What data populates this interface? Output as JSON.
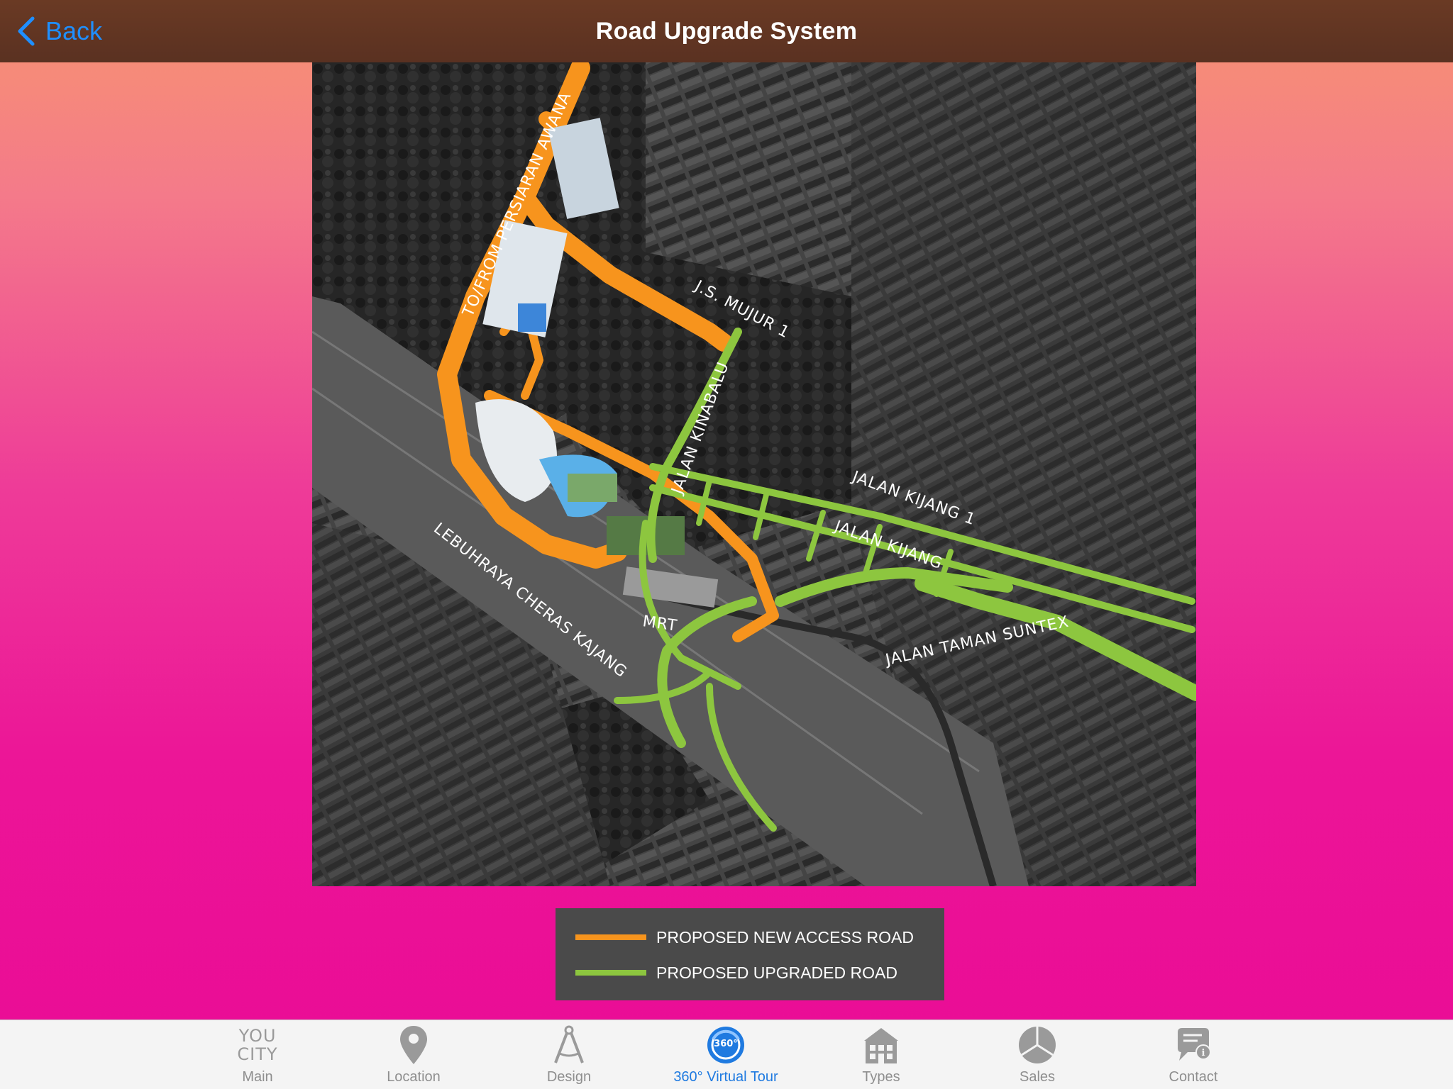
{
  "nav": {
    "back_label": "Back",
    "title": "Road Upgrade System"
  },
  "map": {
    "labels": {
      "persiaran": "TO/FROM PERSIARAN AWANA",
      "mujur": "J.S. MUJUR 1",
      "kinabalu": "JALAN KINABALU",
      "kijang1": "JALAN KIJANG 1",
      "kijang": "JALAN KIJANG",
      "lebuhraya": "LEBUHRAYA CHERAS KAJANG",
      "mrt": "MRT",
      "suntex": "JALAN TAMAN SUNTEX"
    },
    "colors": {
      "new_access_road": "#f7941d",
      "upgraded_road": "#8dc63f"
    }
  },
  "legend": {
    "items": [
      {
        "label": "PROPOSED NEW ACCESS ROAD",
        "color": "#f7941d"
      },
      {
        "label": "PROPOSED UPGRADED ROAD",
        "color": "#8dc63f"
      }
    ]
  },
  "tabbar": {
    "items": [
      {
        "label": "Main",
        "icon": "youcity-logo-icon",
        "active": false
      },
      {
        "label": "Location",
        "icon": "map-pin-icon",
        "active": false
      },
      {
        "label": "Design",
        "icon": "compass-icon",
        "active": false
      },
      {
        "label": "360° Virtual Tour",
        "icon": "virtual-tour-360-icon",
        "active": true
      },
      {
        "label": "Types",
        "icon": "building-icon",
        "active": false
      },
      {
        "label": "Sales",
        "icon": "pie-chart-icon",
        "active": false
      },
      {
        "label": "Contact",
        "icon": "chat-info-icon",
        "active": false
      }
    ],
    "main_logo_top": "YOU",
    "main_logo_bottom": "CITY",
    "active_color": "#1f7ae0",
    "inactive_color": "#8e8e8e"
  }
}
